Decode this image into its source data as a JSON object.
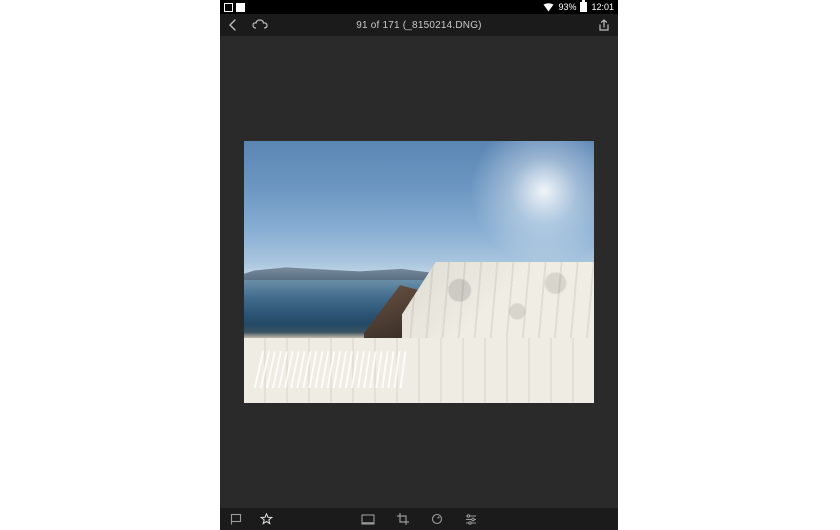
{
  "status_bar": {
    "battery_pct": "93%",
    "time": "12:01"
  },
  "header": {
    "title": "91 of 171 (_8150214.DNG)"
  },
  "icons": {
    "back": "back-chevron-icon",
    "cloud": "cloud-sync-icon",
    "share": "share-icon",
    "flag": "flag-icon",
    "star": "star-icon",
    "filmstrip": "filmstrip-icon",
    "crop": "crop-icon",
    "presets": "presets-icon",
    "adjust": "adjust-sliders-icon"
  }
}
